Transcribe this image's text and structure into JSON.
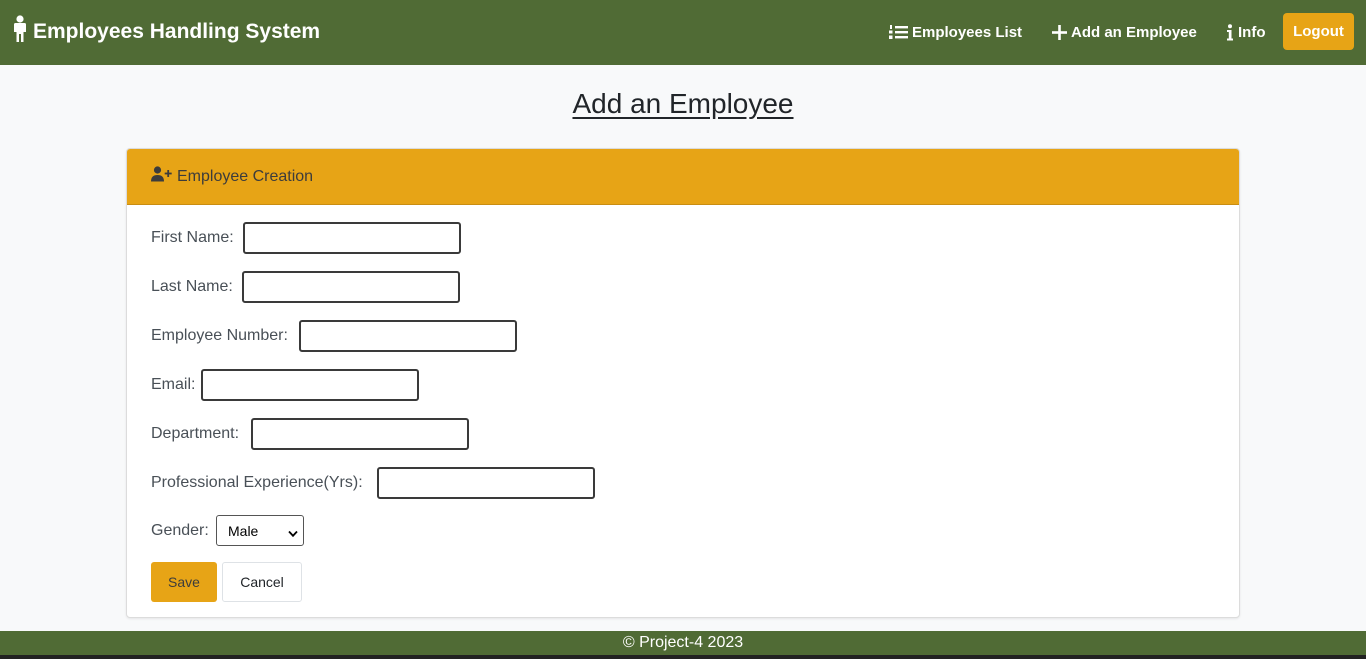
{
  "navbar": {
    "brand": "Employees Handling System",
    "brand_icon": "person-standing-icon",
    "links": [
      {
        "label": "Employees List",
        "icon": "list-ol-icon"
      },
      {
        "label": "Add an Employee",
        "icon": "plus-icon"
      },
      {
        "label": "Info",
        "icon": "info-icon"
      }
    ],
    "logout_label": "Logout",
    "color": "#506b35",
    "accent": "#e7a416"
  },
  "page": {
    "title": "Add an Employee"
  },
  "card": {
    "header": "Employee Creation",
    "header_icon": "user-plus-icon",
    "fields": [
      {
        "label": "First Name:",
        "value": ""
      },
      {
        "label": "Last Name:",
        "value": ""
      },
      {
        "label": "Employee Number:",
        "value": ""
      },
      {
        "label": "Email:",
        "value": ""
      },
      {
        "label": "Department:",
        "value": ""
      },
      {
        "label": "Professional Experience(Yrs):",
        "value": ""
      }
    ],
    "gender": {
      "label": "Gender:",
      "selected": "Male"
    },
    "save_label": "Save",
    "cancel_label": "Cancel"
  },
  "footer": {
    "text": "© Project-4 2023"
  }
}
